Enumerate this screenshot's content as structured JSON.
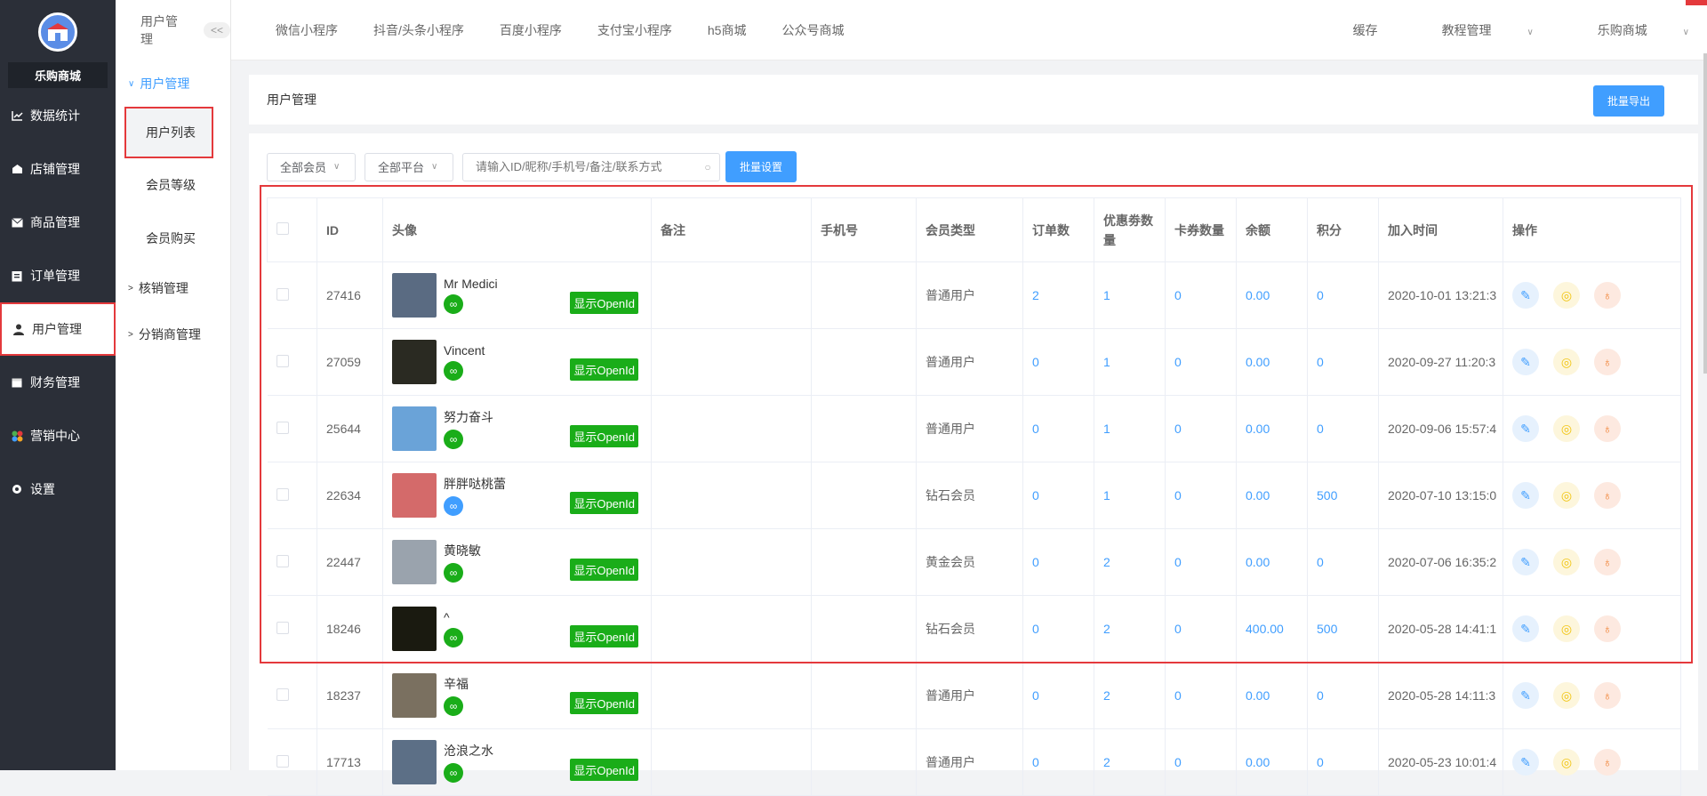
{
  "sidebar": {
    "shop_name": "乐购商城",
    "items": [
      {
        "label": "数据统计",
        "icon": "chart-line-icon"
      },
      {
        "label": "店铺管理",
        "icon": "shop-icon"
      },
      {
        "label": "商品管理",
        "icon": "mail-icon"
      },
      {
        "label": "订单管理",
        "icon": "clipboard-icon"
      },
      {
        "label": "用户管理",
        "icon": "user-icon"
      },
      {
        "label": "财务管理",
        "icon": "calendar-icon"
      },
      {
        "label": "营销中心",
        "icon": "marketing-icon"
      },
      {
        "label": "设置",
        "icon": "gear-icon"
      }
    ]
  },
  "subnav": {
    "title": "用户管理",
    "collapse": "<<",
    "group_open": "用户管理",
    "items": [
      "用户列表",
      "会员等级",
      "会员购买"
    ],
    "groups": [
      "核销管理",
      "分销商管理"
    ]
  },
  "topbar": {
    "tabs": [
      "微信小程序",
      "抖音/头条小程序",
      "百度小程序",
      "支付宝小程序",
      "h5商城",
      "公众号商城"
    ],
    "right": [
      "缓存",
      "教程管理",
      "乐购商城"
    ]
  },
  "panel": {
    "title": "用户管理",
    "export_button": "批量导出"
  },
  "filters": {
    "member": "全部会员",
    "platform": "全部平台",
    "search_placeholder": "请输入ID/昵称/手机号/备注/联系方式",
    "batch_button": "批量设置"
  },
  "table": {
    "headers": [
      "ID",
      "头像",
      "备注",
      "手机号",
      "会员类型",
      "订单数",
      "优惠劵数量",
      "卡券数量",
      "余额",
      "积分",
      "加入时间",
      "操作"
    ],
    "openid_label": "显示OpenId",
    "rows": [
      {
        "id": "27416",
        "name": "Mr Medici",
        "type": "普通用户",
        "orders": "2",
        "coupons": "1",
        "cards": "0",
        "balance": "0.00",
        "points": "0",
        "joined": "2020-10-01 13:21:3",
        "avatar": "#5a6b82",
        "wx": "green"
      },
      {
        "id": "27059",
        "name": "Vincent",
        "type": "普通用户",
        "orders": "0",
        "coupons": "1",
        "cards": "0",
        "balance": "0.00",
        "points": "0",
        "joined": "2020-09-27 11:20:3",
        "avatar": "#2a2a22",
        "wx": "green"
      },
      {
        "id": "25644",
        "name": "努力奋斗",
        "type": "普通用户",
        "orders": "0",
        "coupons": "1",
        "cards": "0",
        "balance": "0.00",
        "points": "0",
        "joined": "2020-09-06 15:57:4",
        "avatar": "#6aa3d8",
        "wx": "green"
      },
      {
        "id": "22634",
        "name": "胖胖哒桃蕾",
        "type": "钻石会员",
        "orders": "0",
        "coupons": "1",
        "cards": "0",
        "balance": "0.00",
        "points": "500",
        "joined": "2020-07-10 13:15:0",
        "avatar": "#d46a6a",
        "wx": "blue"
      },
      {
        "id": "22447",
        "name": "黄晓敏",
        "type": "黄金会员",
        "orders": "0",
        "coupons": "2",
        "cards": "0",
        "balance": "0.00",
        "points": "0",
        "joined": "2020-07-06 16:35:2",
        "avatar": "#9aa3ad",
        "wx": "green"
      },
      {
        "id": "18246",
        "name": "^",
        "type": "钻石会员",
        "orders": "0",
        "coupons": "2",
        "cards": "0",
        "balance": "400.00",
        "points": "500",
        "joined": "2020-05-28 14:41:1",
        "avatar": "#1a1a10",
        "wx": "green"
      },
      {
        "id": "18237",
        "name": "辛福",
        "type": "普通用户",
        "orders": "0",
        "coupons": "2",
        "cards": "0",
        "balance": "0.00",
        "points": "0",
        "joined": "2020-05-28 14:11:3",
        "avatar": "#7a7060",
        "wx": "green"
      },
      {
        "id": "17713",
        "name": "沧浪之水",
        "type": "普通用户",
        "orders": "0",
        "coupons": "2",
        "cards": "0",
        "balance": "0.00",
        "points": "0",
        "joined": "2020-05-23 10:01:4",
        "avatar": "#5c6f86",
        "wx": "green"
      }
    ]
  }
}
